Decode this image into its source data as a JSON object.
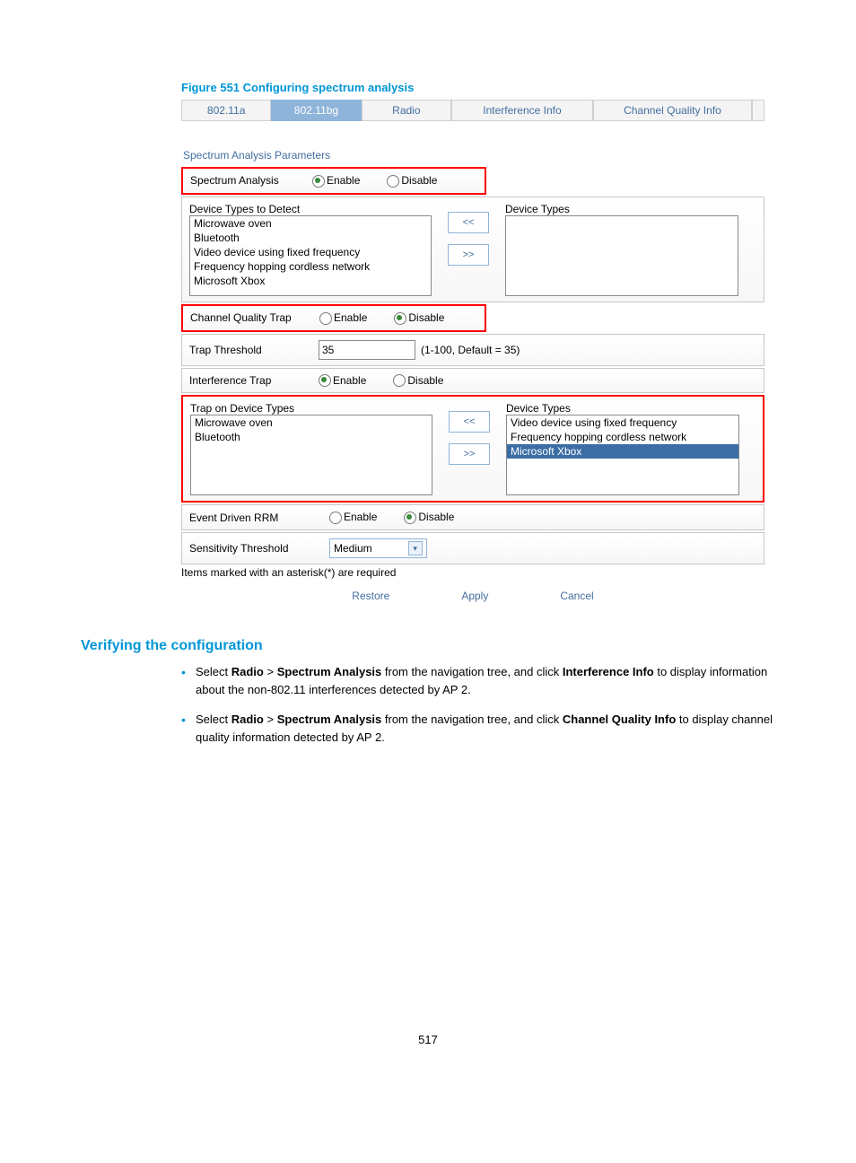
{
  "figure_caption": "Figure 551 Configuring spectrum analysis",
  "tabs": {
    "t0": "802.11a",
    "t1": "802.11bg",
    "t2": "Radio",
    "t3": "Interference Info",
    "t4": "Channel Quality Info"
  },
  "section_title": "Spectrum Analysis Parameters",
  "labels": {
    "spectrum_analysis": "Spectrum Analysis",
    "enable": "Enable",
    "disable": "Disable",
    "device_types_detect": "Device Types to Detect",
    "device_types": "Device Types",
    "channel_quality_trap": "Channel Quality Trap",
    "trap_threshold": "Trap Threshold",
    "trap_threshold_hint": "(1-100, Default = 35)",
    "interference_trap": "Interference Trap",
    "trap_on_device_types": "Trap on Device Types",
    "event_driven_rrm": "Event Driven RRM",
    "sensitivity_threshold": "Sensitivity Threshold",
    "required_note": "Items marked with an asterisk(*) are required"
  },
  "values": {
    "trap_threshold": "35",
    "sensitivity": "Medium"
  },
  "detect_list": {
    "i0": "Microwave oven",
    "i1": "Bluetooth",
    "i2": "Video device using fixed frequency",
    "i3": "Frequency hopping cordless network",
    "i4": "Microsoft Xbox"
  },
  "trap_left": {
    "i0": "Microwave oven",
    "i1": "Bluetooth"
  },
  "trap_right": {
    "i0": "Video device using fixed frequency",
    "i1": "Frequency hopping cordless network",
    "i2": "Microsoft Xbox"
  },
  "transfer_btns": {
    "left": "<<",
    "right": ">>"
  },
  "actions": {
    "restore": "Restore",
    "apply": "Apply",
    "cancel": "Cancel"
  },
  "subheading": "Verifying the configuration",
  "bullets": {
    "b1_pre": "Select ",
    "b1_bold1": "Radio",
    "b1_mid": " > ",
    "b1_bold2": "Spectrum Analysis",
    "b1_post1": " from the navigation tree, and click ",
    "b1_bold3": "Interference Info",
    "b1_tail": " to display information about the non-802.11 interferences detected by AP 2.",
    "b2_pre": "Select ",
    "b2_bold1": "Radio",
    "b2_mid": " > ",
    "b2_bold2": "Spectrum Analysis",
    "b2_post1": " from the navigation tree, and click ",
    "b2_bold3": "Channel Quality Info",
    "b2_tail": " to display channel quality information detected by AP 2."
  },
  "page_number": "517"
}
